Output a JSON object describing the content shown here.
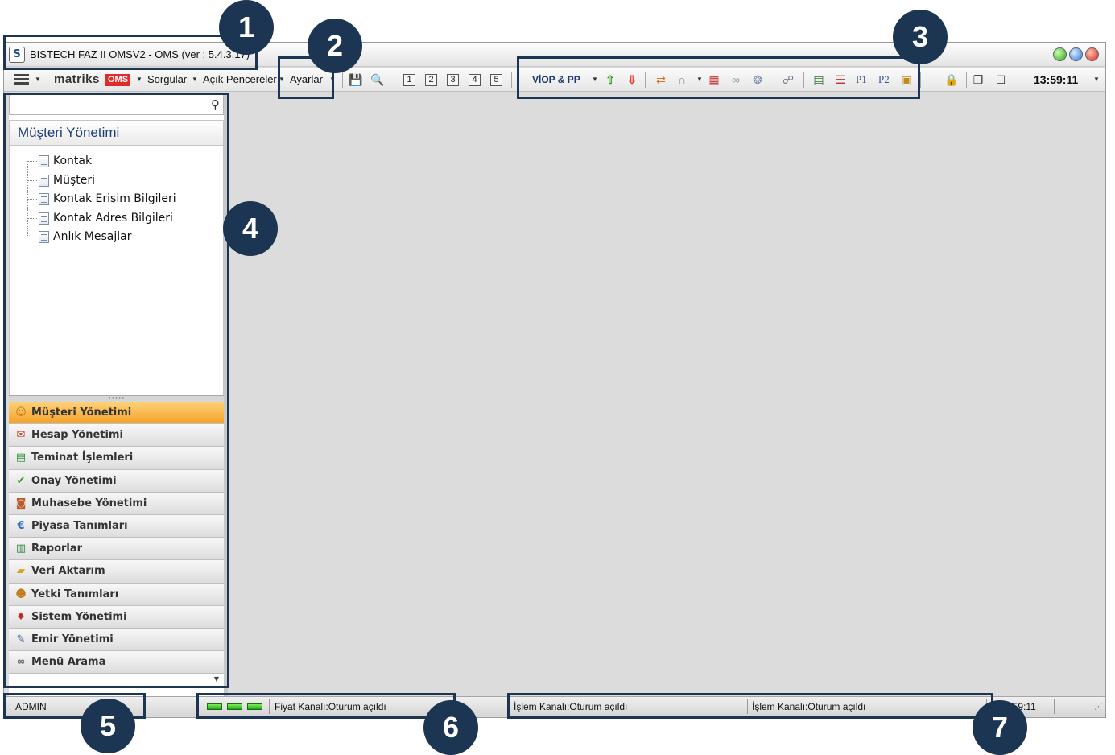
{
  "window": {
    "title": "BISTECH FAZ II OMSV2 - OMS (ver : 5.4.3.17)"
  },
  "toolbar": {
    "logo_text": "matriks",
    "logo_badge": "OMS",
    "menu_sorgular": "Sorgular",
    "menu_acik_pencereler": "Açık Pencereler",
    "menu_ayarlar": "Ayarlar",
    "window_numbers": [
      "1",
      "2",
      "3",
      "4",
      "5"
    ],
    "viop_label": "VİOP & PP",
    "p1_label": "P1",
    "p2_label": "P2",
    "clock": "13:59:11"
  },
  "left_panel": {
    "search_placeholder": "",
    "tree_title": "Müşteri Yönetimi",
    "tree_items": [
      "Kontak",
      "Müşteri",
      "Kontak Erişim Bilgileri",
      "Kontak Adres Bilgileri",
      "Anlık Mesajlar"
    ],
    "nav_items": [
      {
        "label": "Müşteri Yönetimi",
        "icon": "users-icon",
        "active": true
      },
      {
        "label": "Hesap Yönetimi",
        "icon": "account-icon",
        "active": false
      },
      {
        "label": "Teminat İşlemleri",
        "icon": "collateral-icon",
        "active": false
      },
      {
        "label": "Onay Yönetimi",
        "icon": "checkmark-icon",
        "active": false
      },
      {
        "label": "Muhasebe Yönetimi",
        "icon": "accounting-icon",
        "active": false
      },
      {
        "label": "Piyasa Tanımları",
        "icon": "currency-icon",
        "active": false
      },
      {
        "label": "Raporlar",
        "icon": "chart-icon",
        "active": false
      },
      {
        "label": "Veri Aktarım",
        "icon": "folder-icon",
        "active": false
      },
      {
        "label": "Yetki Tanımları",
        "icon": "permissions-icon",
        "active": false
      },
      {
        "label": "Sistem Yönetimi",
        "icon": "pin-icon",
        "active": false
      },
      {
        "label": "Emir Yönetimi",
        "icon": "order-edit-icon",
        "active": false
      },
      {
        "label": "Menü Arama",
        "icon": "binoculars-icon",
        "active": false
      }
    ]
  },
  "status_bar": {
    "user": "ADMIN",
    "price_channel": "Fiyat Kanalı:Oturum açıldı",
    "trade_channel_1": "İşlem Kanalı:Oturum açıldı",
    "trade_channel_2": "İşlem Kanalı:Oturum açıldı",
    "time": "13:59:11"
  },
  "callouts": [
    "1",
    "2",
    "3",
    "4",
    "5",
    "6",
    "7"
  ],
  "colors": {
    "callout": "#1c3552",
    "active_nav": "#f4a12a",
    "tree_title": "#1c3f7a",
    "oms_badge": "#e22a2a"
  }
}
